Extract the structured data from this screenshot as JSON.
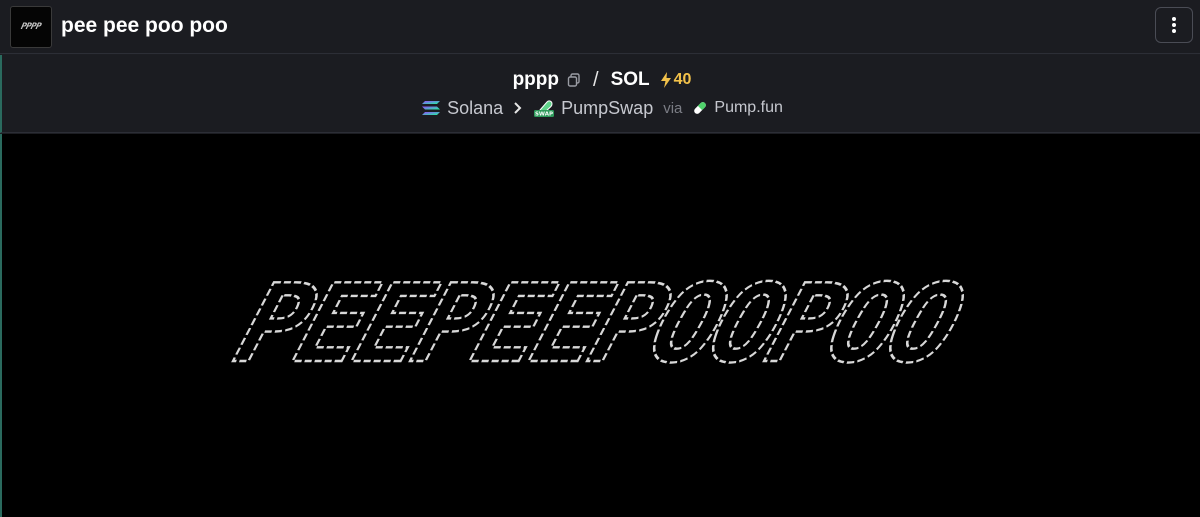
{
  "header": {
    "logo_text": "PPPP",
    "title": "pee pee poo poo",
    "menu_icon": "vertical-ellipsis-icon"
  },
  "pair": {
    "base_symbol": "pppp",
    "separator": "/",
    "quote_symbol": "SOL",
    "boost_count": "40",
    "boost_icon": "lightning-bolt-icon",
    "boost_color": "#f2c14a"
  },
  "route": {
    "chain": "Solana",
    "dex": "PumpSwap",
    "via_label": "via",
    "launchpad": "Pump.fun"
  },
  "banner": {
    "art_text": "PEEPEEPOOPOO"
  }
}
